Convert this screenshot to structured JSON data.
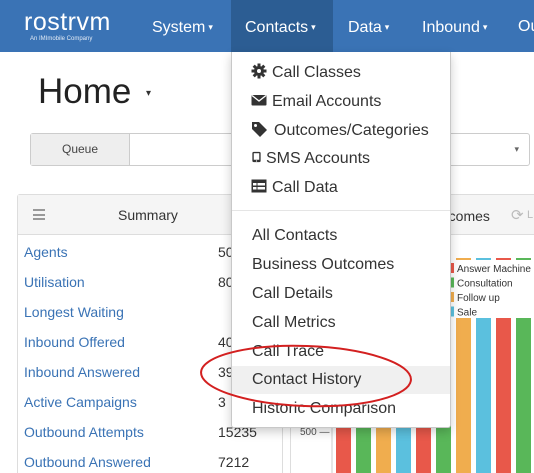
{
  "brand": {
    "name": "rostrvm",
    "tagline": "An IMImobile Company"
  },
  "nav": [
    {
      "label": "System",
      "caret": "▾"
    },
    {
      "label": "Contacts",
      "caret": "▾"
    },
    {
      "label": "Data",
      "caret": "▾"
    },
    {
      "label": "Inbound",
      "caret": "▾"
    },
    {
      "label": "Ou"
    }
  ],
  "page": {
    "title": "Home",
    "title_caret": "▾"
  },
  "queue": {
    "label": "Queue",
    "value": "",
    "caret": "▾"
  },
  "summary": {
    "title": "Summary",
    "rows": [
      {
        "label": "Agents",
        "value": "50"
      },
      {
        "label": "Utilisation",
        "value": "80"
      },
      {
        "label": "Longest Waiting",
        "value": ""
      },
      {
        "label": "Inbound Offered",
        "value": "40"
      },
      {
        "label": "Inbound Answered",
        "value": "39"
      },
      {
        "label": "Active Campaigns",
        "value": "3"
      },
      {
        "label": "Outbound Attempts",
        "value": "15235"
      },
      {
        "label": "Outbound Answered",
        "value": "7212"
      }
    ]
  },
  "outcomes_panel": {
    "title": "utcomes",
    "extra": "L"
  },
  "chart_data": {
    "type": "bar",
    "title": "",
    "legend": [
      "Answer Machine",
      "Consultation",
      "Follow up",
      "Sale"
    ],
    "legend_placement": "top-right",
    "colors": [
      "#e8584a",
      "#59b759",
      "#f0ad4e",
      "#5bc0de"
    ],
    "yticks": [
      "500"
    ],
    "series": [
      {
        "name": "Answer Machine",
        "values": [
          null
        ]
      },
      {
        "name": "Consultation",
        "values": [
          null
        ]
      },
      {
        "name": "Follow up",
        "values": [
          null
        ]
      },
      {
        "name": "Sale",
        "values": [
          null
        ]
      }
    ]
  },
  "contacts_menu": {
    "items": [
      {
        "label": "Call Classes",
        "icon": "cog-icon"
      },
      {
        "label": "Email Accounts",
        "icon": "envelope-icon"
      },
      {
        "label": "Outcomes/Categories",
        "icon": "tags-icon"
      },
      {
        "label": "SMS Accounts",
        "icon": "mobile-icon"
      },
      {
        "label": "Call Data",
        "icon": "table-icon"
      }
    ],
    "links": [
      "All Contacts",
      "Business Outcomes",
      "Call Details",
      "Call Metrics",
      "Call Trace",
      "Contact History",
      "Historic Comparison"
    ],
    "highlighted": "Contact History"
  },
  "annotation": {
    "shape": "ellipse",
    "color": "#d32020",
    "target": "Contact History"
  }
}
